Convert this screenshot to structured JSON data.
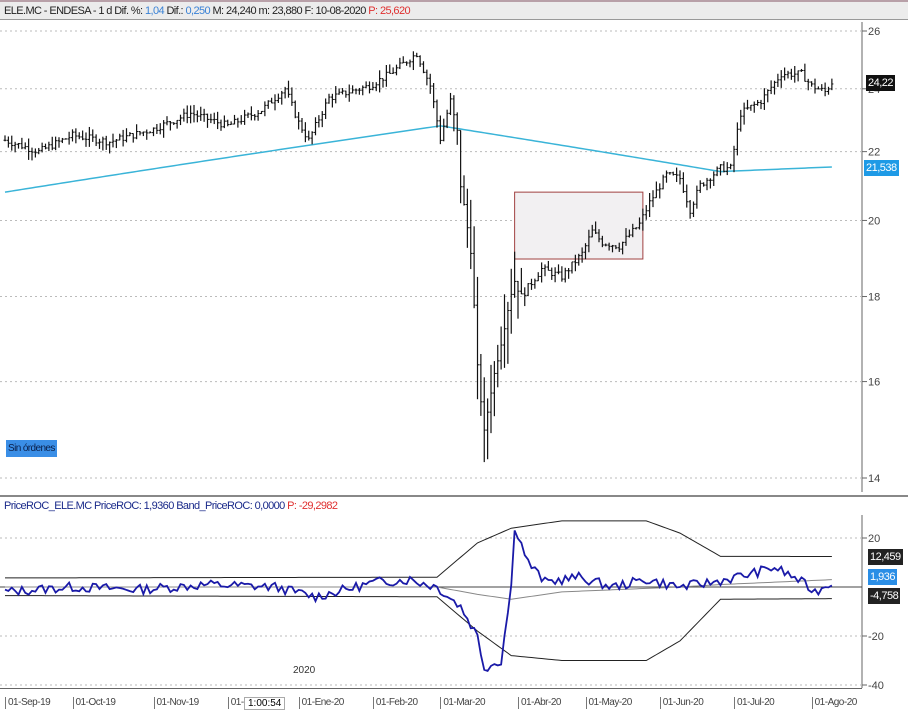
{
  "header": {
    "symbol": "ELE.MC - ENDESA - 1 d",
    "dif_pct_label": "Dif. %:",
    "dif_pct": "1,04",
    "dif_label": "Dif.:",
    "dif": "0,250",
    "max": "M: 24,240",
    "min": "m: 23,880",
    "date": "F: 10-08-2020",
    "p_label": "P:",
    "p": "25,620"
  },
  "sub_header": {
    "name": "PriceROC_ELE.MC",
    "roc": "PriceROC: 1,9360",
    "band": "Band_PriceROC: 0,0000",
    "p_label": "P:",
    "p": "-29,2982"
  },
  "orders_badge": "Sin órdenes",
  "year_label": "2020",
  "cursor_time": "1:00:54",
  "colors": {
    "price": "#111111",
    "ma": "#3ab4d8",
    "roc": "#1a1aa8",
    "band": "#222222",
    "mid": "#888888",
    "last_tag": "#111111",
    "ma_tag": "#1e9ae6",
    "box_fill": "#f2f0f2",
    "box_stroke": "#a04040"
  },
  "chart_data": [
    {
      "type": "ohlc",
      "title": "ELE.MC - ENDESA",
      "yscale": "log",
      "ylim": [
        14,
        26
      ],
      "yticks": [
        "26",
        "24",
        "22",
        "20",
        "18",
        "16",
        "14"
      ],
      "ytick_values": [
        26,
        24,
        22,
        20,
        18,
        16,
        14
      ],
      "x_days": 245,
      "x_labels": [
        {
          "day": 0,
          "label": "01-Sep-19"
        },
        {
          "day": 20,
          "label": "01-Oct-19"
        },
        {
          "day": 44,
          "label": "01-Nov-19"
        },
        {
          "day": 66,
          "label": "01-Dic-19"
        },
        {
          "day": 87,
          "label": "01-Ene-20"
        },
        {
          "day": 109,
          "label": "01-Feb-20"
        },
        {
          "day": 129,
          "label": "01-Mar-20"
        },
        {
          "day": 152,
          "label": "01-Abr-20"
        },
        {
          "day": 172,
          "label": "01-May-20"
        },
        {
          "day": 194,
          "label": "01-Jun-20"
        },
        {
          "day": 216,
          "label": "01-Jul-20"
        },
        {
          "day": 239,
          "label": "01-Ago-20"
        }
      ],
      "close_keypoints": [
        [
          0,
          22.35
        ],
        [
          10,
          22.0
        ],
        [
          20,
          22.5
        ],
        [
          31,
          22.3
        ],
        [
          44,
          22.7
        ],
        [
          55,
          23.2
        ],
        [
          66,
          22.8
        ],
        [
          76,
          23.3
        ],
        [
          83,
          24.0
        ],
        [
          87,
          22.9
        ],
        [
          90,
          22.35
        ],
        [
          96,
          23.7
        ],
        [
          108,
          24.1
        ],
        [
          114,
          24.5
        ],
        [
          122,
          25.2
        ],
        [
          126,
          24.1
        ],
        [
          129,
          22.4
        ],
        [
          132,
          23.6
        ],
        [
          134,
          22.6
        ],
        [
          135,
          21.0
        ],
        [
          138,
          19.2
        ],
        [
          140,
          16.3
        ],
        [
          142,
          14.9
        ],
        [
          144,
          15.8
        ],
        [
          147,
          16.9
        ],
        [
          150,
          18.1
        ],
        [
          151,
          18.4
        ],
        [
          153,
          18.0
        ],
        [
          159,
          18.7
        ],
        [
          165,
          18.5
        ],
        [
          171,
          19.1
        ],
        [
          174,
          19.7
        ],
        [
          177,
          19.4
        ],
        [
          182,
          19.3
        ],
        [
          188,
          19.9
        ],
        [
          191,
          20.5
        ],
        [
          196,
          21.3
        ],
        [
          200,
          21.2
        ],
        [
          203,
          20.3
        ],
        [
          206,
          21.0
        ],
        [
          212,
          21.5
        ],
        [
          215,
          21.5
        ],
        [
          218,
          23.2
        ],
        [
          224,
          23.6
        ],
        [
          230,
          24.5
        ],
        [
          236,
          24.5
        ],
        [
          239,
          24.1
        ],
        [
          243,
          23.9
        ],
        [
          245,
          24.22
        ]
      ],
      "ma_keypoints": [
        [
          0,
          20.8
        ],
        [
          129,
          22.8
        ],
        [
          212,
          21.4
        ],
        [
          245,
          21.538
        ]
      ],
      "rectangle": {
        "day_from": 151,
        "day_to": 189,
        "price_high": 20.8,
        "price_low": 18.96
      },
      "last_price_label": "24,22",
      "ma_label": "21,538"
    },
    {
      "type": "line",
      "title": "PriceROC_ELE.MC",
      "ylim": [
        -40,
        28
      ],
      "yticks": [
        "20",
        "-20",
        "-40"
      ],
      "ytick_values": [
        20,
        -20,
        -40
      ],
      "series": [
        {
          "name": "PriceROC",
          "keypoints": [
            [
              0,
              -2
            ],
            [
              20,
              0
            ],
            [
              40,
              -1
            ],
            [
              60,
              1
            ],
            [
              80,
              0
            ],
            [
              92,
              -4
            ],
            [
              110,
              2
            ],
            [
              120,
              3
            ],
            [
              128,
              0
            ],
            [
              135,
              -8
            ],
            [
              140,
              -20
            ],
            [
              142,
              -33
            ],
            [
              147,
              -30
            ],
            [
              150,
              0
            ],
            [
              151,
              25
            ],
            [
              155,
              10
            ],
            [
              160,
              2
            ],
            [
              170,
              4
            ],
            [
              180,
              0
            ],
            [
              190,
              3
            ],
            [
              200,
              0
            ],
            [
              210,
              2
            ],
            [
              220,
              5
            ],
            [
              228,
              8
            ],
            [
              235,
              3
            ],
            [
              240,
              -2
            ],
            [
              245,
              1.936
            ]
          ]
        },
        {
          "name": "Band upper",
          "keypoints": [
            [
              0,
              3.7
            ],
            [
              128,
              4
            ],
            [
              140,
              18
            ],
            [
              150,
              24
            ],
            [
              165,
              27
            ],
            [
              190,
              27
            ],
            [
              200,
              22
            ],
            [
              212,
              12.5
            ],
            [
              245,
              12.459
            ]
          ]
        },
        {
          "name": "Band lower",
          "keypoints": [
            [
              0,
              -3.5
            ],
            [
              128,
              -4
            ],
            [
              140,
              -18
            ],
            [
              150,
              -28
            ],
            [
              165,
              -30
            ],
            [
              190,
              -30
            ],
            [
              200,
              -22
            ],
            [
              212,
              -5
            ],
            [
              245,
              -4.758
            ]
          ]
        },
        {
          "name": "Middle",
          "keypoints": [
            [
              0,
              0
            ],
            [
              128,
              0
            ],
            [
              140,
              -3
            ],
            [
              150,
              -5
            ],
            [
              165,
              -2
            ],
            [
              200,
              0
            ],
            [
              212,
              1
            ],
            [
              245,
              3
            ]
          ]
        }
      ],
      "labels": {
        "upper": "12,459",
        "roc": "1,936",
        "lower": "-4,758"
      }
    }
  ]
}
